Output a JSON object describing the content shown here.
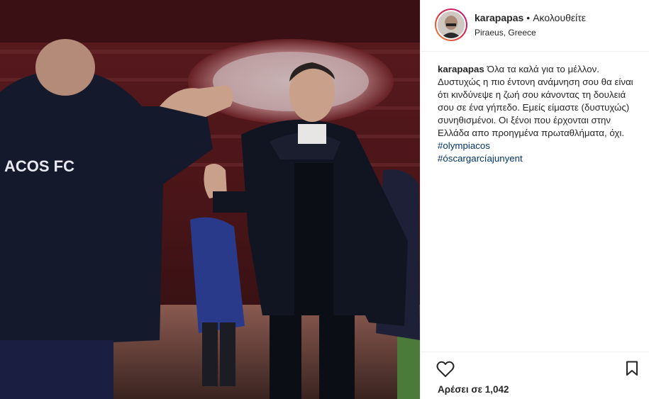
{
  "post": {
    "photo_alt": "Soccer coach in dark Adidas jacket shaking hands in stadium",
    "jacket_text": "ACOS FC"
  },
  "header": {
    "username": "karapapas",
    "separator": "•",
    "follow_label": "Ακολουθείτε",
    "location": "Piraeus, Greece"
  },
  "caption": {
    "username": "karapapas",
    "text": "Όλα τα καλά για το μέλλον. Δυστυχώς η πιο έντονη ανάμνηση σου θα είναι ότι κινδύνεψε η ζωή σου κάνοντας τη δουλειά σου σε ένα γήπεδο. Εμείς είμαστε (δυστυχώς) συνηθισμένοι. Οι ξένοι που έρχονται στην Ελλάδα απο προηγμένα πρωταθλήματα, όχι.",
    "hashtags": [
      "#olympiacos",
      "#óscargarcíajunyent"
    ]
  },
  "actions": {
    "like_icon": "heart-icon",
    "save_icon": "bookmark-icon",
    "likes_text": "Αρέσει σε 1,042"
  },
  "colors": {
    "text": "#262626",
    "hashtag": "#003569",
    "border": "#efefef"
  }
}
